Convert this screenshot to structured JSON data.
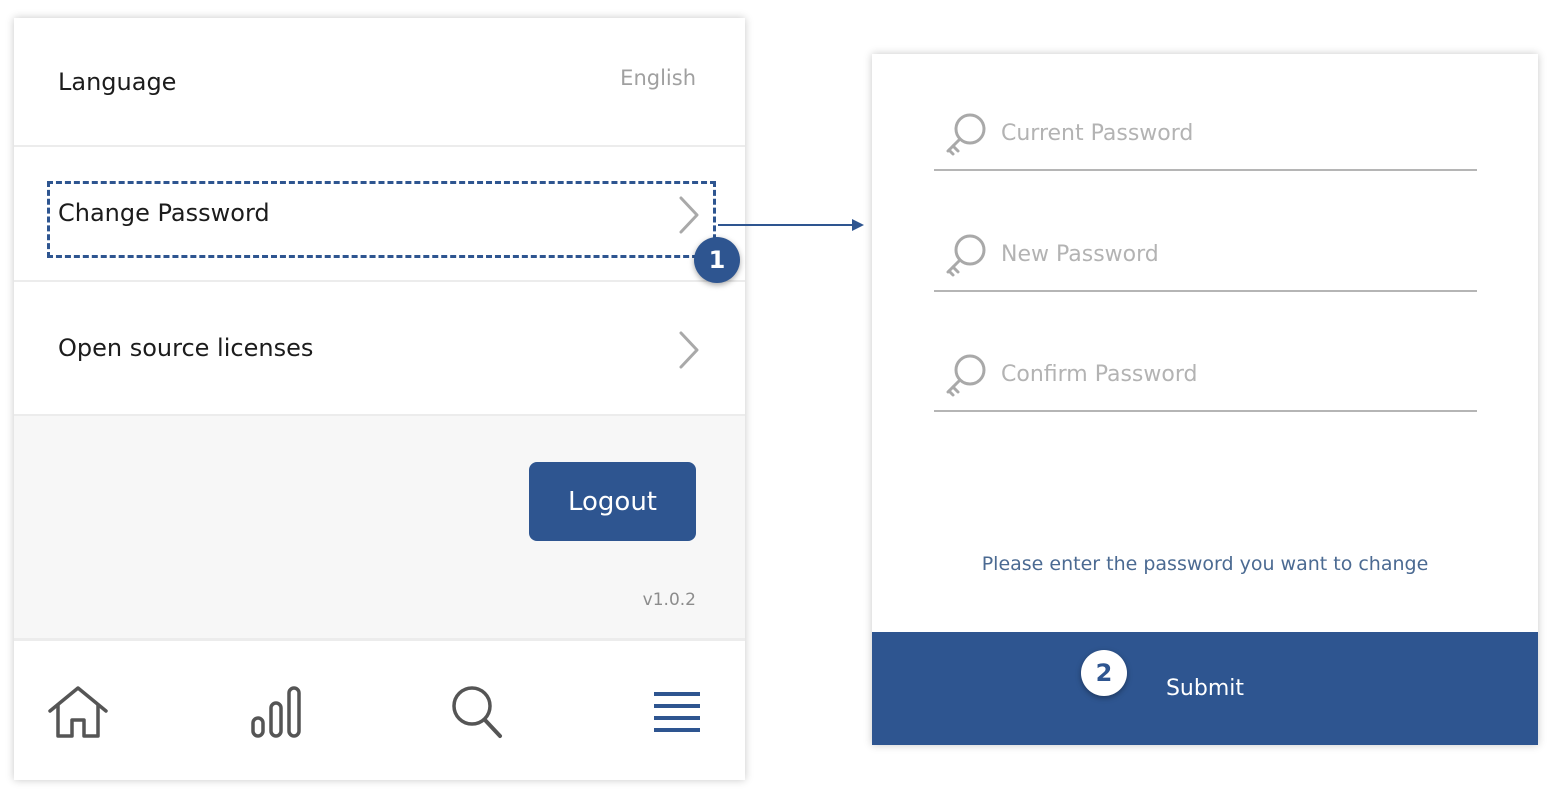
{
  "settings": {
    "language_label": "Language",
    "language_value": "English",
    "change_password_label": "Change Password",
    "licenses_label": "Open source licenses",
    "logout_label": "Logout",
    "version": "v1.0.2",
    "tabs": [
      {
        "icon": "home-icon"
      },
      {
        "icon": "bar-chart-icon"
      },
      {
        "icon": "search-icon"
      },
      {
        "icon": "menu-icon"
      }
    ]
  },
  "callouts": {
    "step1": "1",
    "step2": "2"
  },
  "change_password_form": {
    "current_placeholder": "Current Password",
    "new_placeholder": "New Password",
    "confirm_placeholder": "Confirm Password",
    "hint": "Please enter the password you want to change",
    "submit_label": "Submit"
  },
  "colors": {
    "primary": "#2e5590",
    "hint_text": "#4b6a92",
    "muted": "#a0a0a0"
  }
}
